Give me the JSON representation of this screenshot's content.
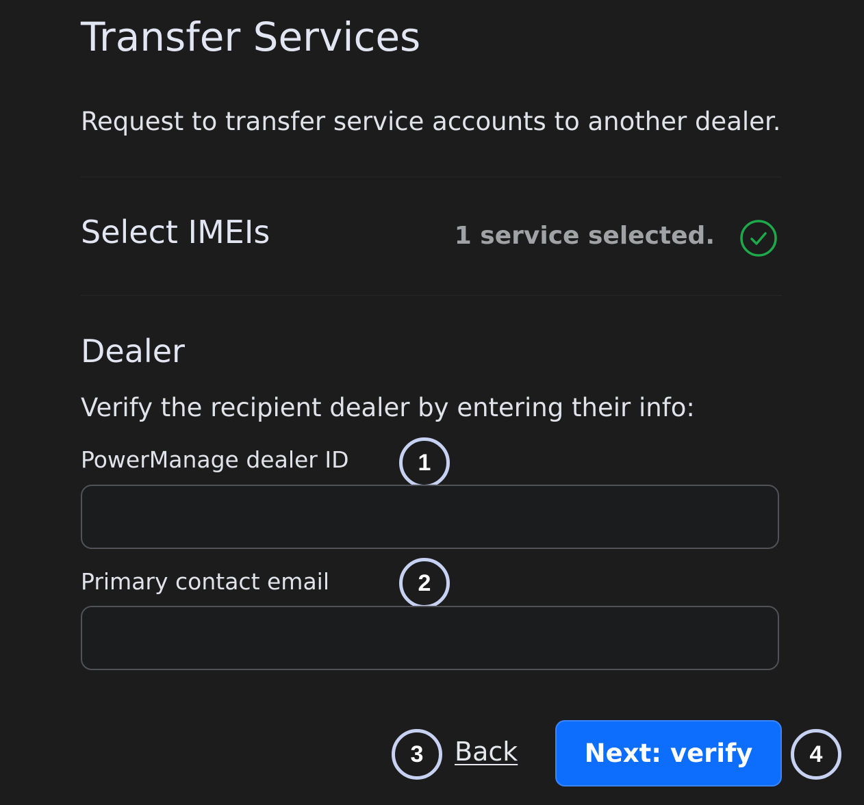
{
  "header": {
    "title": "Transfer Services",
    "subtitle": "Request to transfer service accounts to another dealer."
  },
  "imei_section": {
    "title": "Select IMEIs",
    "status": "1 service selected.",
    "status_icon": "check-circle-icon",
    "status_color": "#1fa84a"
  },
  "dealer_section": {
    "title": "Dealer",
    "description": "Verify the recipient dealer by entering their info:",
    "fields": [
      {
        "label": "PowerManage dealer ID",
        "value": "",
        "badge": "1"
      },
      {
        "label": "Primary contact email",
        "value": "",
        "badge": "2"
      }
    ]
  },
  "actions": {
    "back_label": "Back",
    "back_badge": "3",
    "next_label": "Next: verify",
    "next_badge": "4",
    "accent_color": "#0d6efd"
  },
  "colors": {
    "background": "#1c1c1c",
    "badge_ring": "#c7d2f2"
  }
}
